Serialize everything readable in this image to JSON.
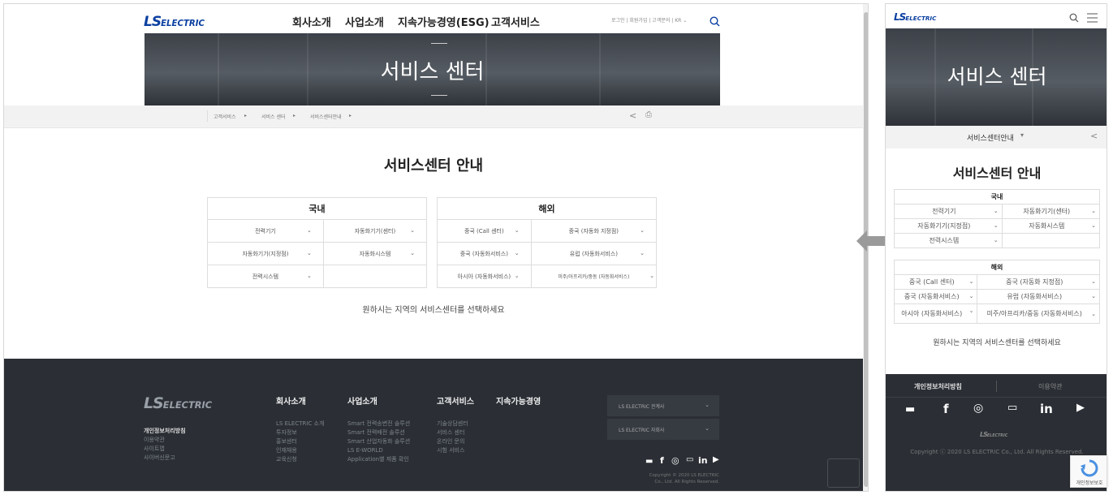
{
  "desktop": {
    "brand": {
      "logo_ls": "LS",
      "logo_word": "ELECTRIC"
    },
    "nav": [
      "회사소개",
      "사업소개",
      "지속가능경영(ESG)",
      "고객서비스"
    ],
    "util": "로그인 | 회원가입 | 고객문의 | KR ⌄",
    "hero_title": "서비스 센터",
    "breadcrumb": [
      "고객서비스",
      "서비스 센터",
      "서비스센터안내"
    ],
    "section_title": "서비스센터 안내",
    "domestic": {
      "header": "국내",
      "rows": [
        [
          "전력기기",
          "자동화기기(센터)"
        ],
        [
          "자동화기기(지정점)",
          "자동화시스템"
        ],
        [
          "전력시스템",
          ""
        ]
      ]
    },
    "overseas": {
      "header": "해외",
      "rows": [
        [
          "중국 (Call 센터)",
          "중국 (자동화 지정점)"
        ],
        [
          "중국 (자동화서비스)",
          "유럽 (자동화서비스)"
        ],
        [
          "아시아 (자동화서비스)",
          "미주/아프리카/중동 (자동화서비스)"
        ]
      ]
    },
    "help_text": "원하시는 지역의 서비스센터를 선택하세요",
    "footer": {
      "left_links": [
        "개인정보처리방침",
        "이용약관",
        "사이트맵",
        "사이버신문고"
      ],
      "cols": [
        {
          "head": "회사소개",
          "items": [
            "LS ELECTRIC 소개",
            "투자정보",
            "홍보센터",
            "인재채용",
            "교육신청"
          ]
        },
        {
          "head": "사업소개",
          "items": [
            "Smart 전력송변전 솔루션",
            "Smart 전력배전 솔루션",
            "Smart 산업자동화 솔루션",
            "LS E-WORLD",
            "Application별 제품 확인"
          ]
        },
        {
          "head": "고객서비스",
          "items": [
            "기술상담센터",
            "서비스 센터",
            "온라인 문의",
            "시험 서비스"
          ]
        },
        {
          "head": "지속가능경영",
          "items": []
        }
      ],
      "select1": "LS ELECTRIC 관계사",
      "select2": "LS ELECTRIC 자회사",
      "copyright1": "Copyright © 2020 LS ELECTRIC",
      "copyright2": "Co., Ltd. All Rights Reserved."
    }
  },
  "mobile": {
    "hero_title": "서비스 센터",
    "page_select": "서비스센터안내",
    "section_title": "서비스센터 안내",
    "domestic": {
      "header": "국내",
      "rows": [
        [
          "전력기기",
          "자동화기기(센터)"
        ],
        [
          "자동화기기(지정점)",
          "자동화시스템"
        ],
        [
          "전력시스템",
          ""
        ]
      ]
    },
    "overseas": {
      "header": "해외",
      "rows": [
        [
          "중국 (Call 센터)",
          "중국 (자동화 지정점)"
        ],
        [
          "중국 (자동화서비스)",
          "유럽 (자동화서비스)"
        ],
        [
          "아시아 (자동화서비스)",
          "미주/아프리카/중동 (자동화서비스)"
        ]
      ]
    },
    "help_text": "원하시는 지역의 서비스센터를 선택하세요",
    "footer": {
      "privacy": "개인정보처리방침",
      "terms": "이용약관",
      "copyright": "Copyright ⓒ 2020 LS ELECTRIC Co., Ltd. All Rights Reserved."
    },
    "recaptcha_label": "개인정보보호"
  },
  "colors": {
    "brand": "#0a3fa0",
    "footer": "#2b2f35",
    "arrow": "#9a9a9a"
  }
}
